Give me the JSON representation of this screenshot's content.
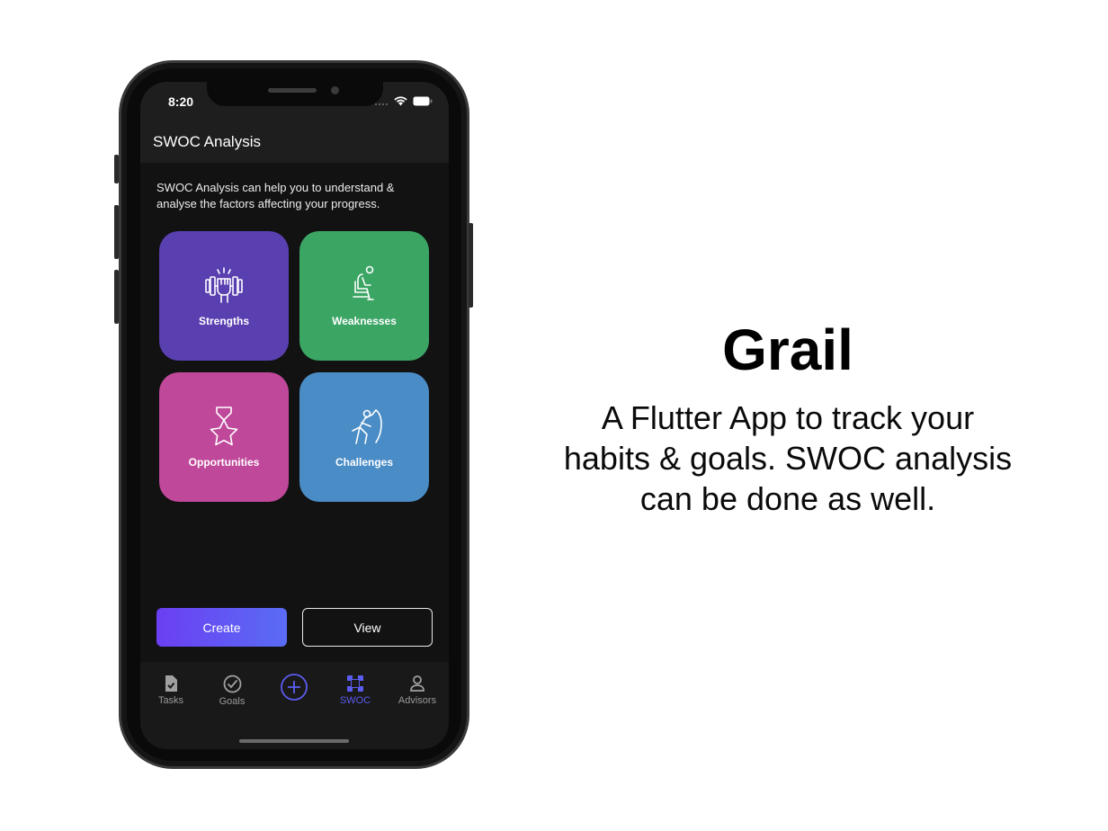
{
  "status_bar": {
    "time": "8:20"
  },
  "app_bar": {
    "title": "SWOC Analysis"
  },
  "description": "SWOC Analysis can help you to understand & analyse the factors affecting your progress.",
  "tiles": [
    {
      "label": "Strengths",
      "icon": "dumbbell-fist-icon",
      "color": "#5a3fb0"
    },
    {
      "label": "Weaknesses",
      "icon": "sitting-person-icon",
      "color": "#3ba564"
    },
    {
      "label": "Opportunities",
      "icon": "star-medal-icon",
      "color": "#c0489b"
    },
    {
      "label": "Challenges",
      "icon": "pushing-person-icon",
      "color": "#4a8cc6"
    }
  ],
  "actions": {
    "create_label": "Create",
    "view_label": "View"
  },
  "bottom_nav": {
    "items": [
      {
        "label": "Tasks",
        "icon": "task-file-icon",
        "active": false
      },
      {
        "label": "Goals",
        "icon": "check-circle-icon",
        "active": false
      },
      {
        "label": "",
        "icon": "add-circle-icon",
        "active": false
      },
      {
        "label": "SWOC",
        "icon": "swoc-grid-icon",
        "active": true
      },
      {
        "label": "Advisors",
        "icon": "person-icon",
        "active": false
      }
    ],
    "active_color": "#5b5cf0"
  },
  "promo": {
    "headline": "Grail",
    "tagline_lines": [
      "A Flutter App to track your",
      "habits & goals. SWOC analysis",
      "can be done as well."
    ]
  }
}
